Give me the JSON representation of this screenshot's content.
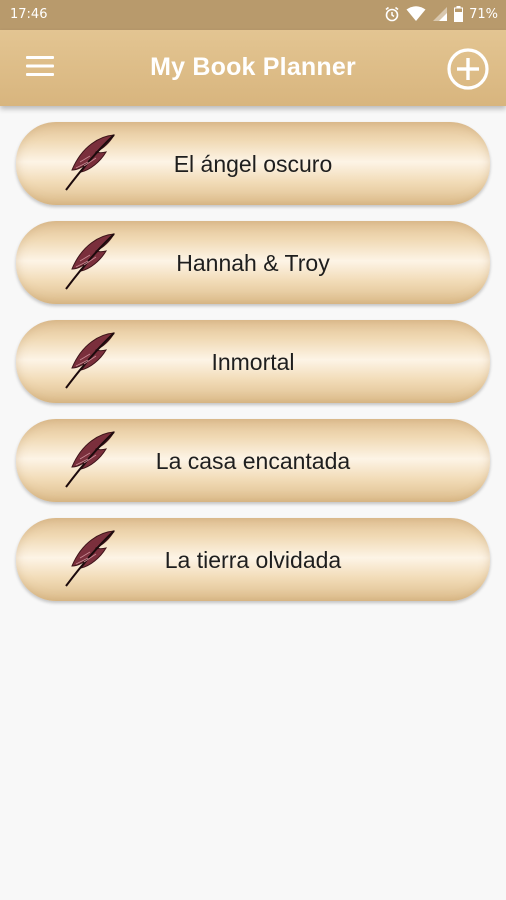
{
  "status_bar": {
    "time": "17:46",
    "battery": "71%",
    "icons": [
      "alarm-icon",
      "wifi-icon",
      "signal-icon",
      "battery-icon"
    ]
  },
  "app_bar": {
    "title": "My Book Planner",
    "menu_icon": "hamburger-menu-icon",
    "add_icon": "add-circle-icon"
  },
  "books": [
    {
      "title": "El ángel oscuro",
      "icon": "quill-icon"
    },
    {
      "title": "Hannah & Troy",
      "icon": "quill-icon"
    },
    {
      "title": "Inmortal",
      "icon": "quill-icon"
    },
    {
      "title": "La casa encantada",
      "icon": "quill-icon"
    },
    {
      "title": "La tierra olvidada",
      "icon": "quill-icon"
    }
  ],
  "colors": {
    "status_bar": "#b89a6c",
    "app_bar": "#dcbb86",
    "background": "#f8f8f8",
    "item_highlight": "#fdf4e6",
    "item_edge": "#ddbd8c",
    "quill": "#7a2f3c"
  }
}
